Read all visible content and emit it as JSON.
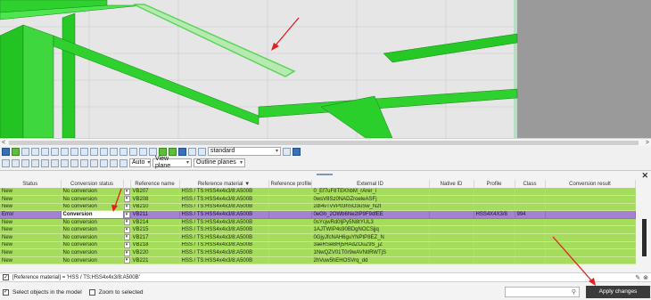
{
  "toolbar": {
    "view_select": "standard",
    "auto_select": "Auto",
    "view_plane_select": "View plane",
    "outline_planes_select": "Outline planes"
  },
  "table": {
    "columns": [
      "Status",
      "Conversion status",
      "Reference name",
      "Reference material",
      "Reference profile",
      "External ID",
      "Native ID",
      "Profile",
      "Class",
      "Conversion result"
    ],
    "rows": [
      {
        "status": "New",
        "conversion_status": "No conversion",
        "name": "VB207",
        "material": "HSS / TS:HSS4x4x3/8:A500B",
        "profile": "",
        "external_id": "0_Ef7uF8TEKhbM_rArer_i",
        "native_id": "",
        "profile2": "",
        "class": "",
        "result": "",
        "kind": "ok"
      },
      {
        "status": "New",
        "conversion_status": "No conversion",
        "name": "VB208",
        "material": "HSS / TS:HSS4x4x3/8:A500B",
        "profile": "",
        "external_id": "0wsV8Sz0NADZroeleASFj",
        "native_id": "",
        "profile2": "",
        "class": "",
        "result": "",
        "kind": "ok"
      },
      {
        "status": "New",
        "conversion_status": "No conversion",
        "name": "VB210",
        "material": "HSS / TS:HSS4x4x3/8:A500B",
        "profile": "",
        "external_id": "2dI4vTvVP03hSO3uSw_N2t",
        "native_id": "",
        "profile2": "",
        "class": "",
        "result": "",
        "kind": "ok"
      },
      {
        "status": "Error",
        "conversion_status": "Conversion",
        "name": "VB211",
        "material": "HSS / TS:HSS4x4x3/8:A500B",
        "profile": "",
        "external_id": "0eGh_2OWb6Ne2IP9F9dfEE",
        "native_id": "",
        "profile2": "HSS4X4X3/8",
        "class": "994",
        "result": "",
        "kind": "err"
      },
      {
        "status": "New",
        "conversion_status": "No conversion",
        "name": "VB214",
        "material": "HSS / TS:HSS4x4x3/8:A500B",
        "profile": "",
        "external_id": "0sYcjwRd0ljPy5N8tYUL3",
        "native_id": "",
        "profile2": "",
        "class": "",
        "result": "",
        "kind": "ok"
      },
      {
        "status": "New",
        "conversion_status": "No conversion",
        "name": "VB215",
        "material": "HSS / TS:HSS4x4x3/8:A500B",
        "profile": "",
        "external_id": "1AJTWIP4s90BDgNOCSjjq",
        "native_id": "",
        "profile2": "",
        "class": "",
        "result": "",
        "kind": "ok"
      },
      {
        "status": "New",
        "conversion_status": "No conversion",
        "name": "VB217",
        "material": "HSS / TS:HSS4x4x3/8:A500B",
        "profile": "",
        "external_id": "0GjyJfcNAH6guYNPtP8EZ_N",
        "native_id": "",
        "profile2": "",
        "class": "",
        "result": "",
        "kind": "ok"
      },
      {
        "status": "New",
        "conversion_status": "No conversion",
        "name": "VB218",
        "material": "HSS / TS:HSS4x4x3/8:A500B",
        "profile": "",
        "external_id": "3aeRSeBHj5HAdZOuZ9S_jZ",
        "native_id": "",
        "profile2": "",
        "class": "",
        "result": "",
        "kind": "ok"
      },
      {
        "status": "New",
        "conversion_status": "No conversion",
        "name": "VB220",
        "material": "HSS / TS:HSS4x4x3/8:A500B",
        "profile": "",
        "external_id": "1NwQZV01T0r9wAVNtlRWTjS",
        "native_id": "",
        "profile2": "",
        "class": "",
        "result": "",
        "kind": "ok"
      },
      {
        "status": "New",
        "conversion_status": "No conversion",
        "name": "VB221",
        "material": "HSS / TS:HSS4x4x3/8:A500B",
        "profile": "",
        "external_id": "2hVuw5hEHOSVrq_dd",
        "native_id": "",
        "profile2": "",
        "class": "",
        "result": "",
        "kind": "ok"
      }
    ]
  },
  "filter": {
    "text": "[Reference material] = 'HSS / TS:HSS4x4x3/8:A500B'"
  },
  "bottom": {
    "select_objects_label": "Select objects in the model",
    "zoom_label": "Zoom to selected",
    "search_placeholder": "",
    "apply_label": "Apply changes"
  },
  "colors": {
    "row_ok": "#a6dc5c",
    "row_error": "#a383cf",
    "beam": "#22cc22",
    "annotation_arrow": "#e02020"
  }
}
